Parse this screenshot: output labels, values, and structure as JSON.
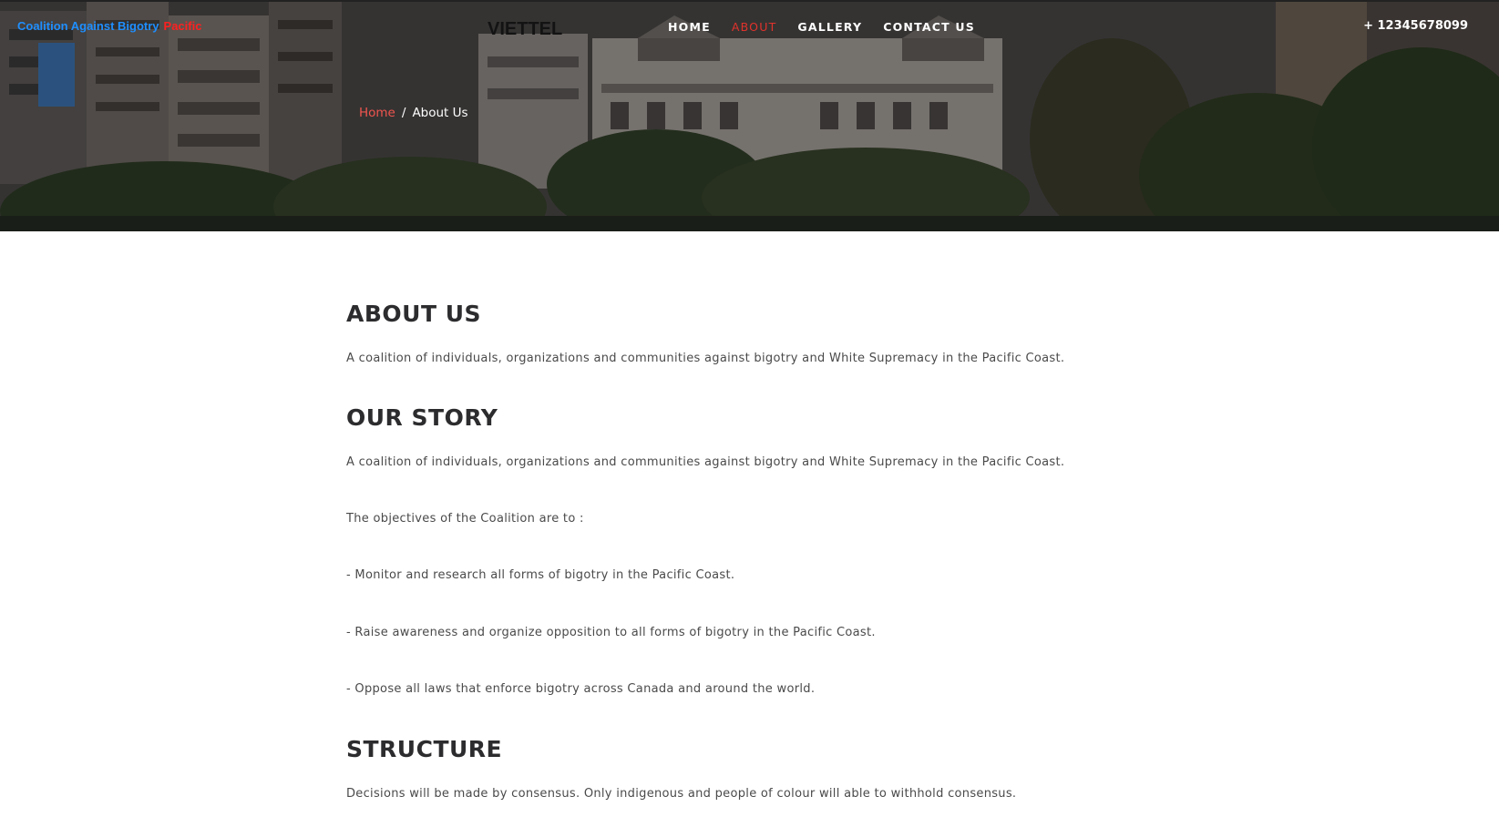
{
  "header": {
    "brand_primary": "Coalition Against Bigotry",
    "brand_secondary": "Pacific",
    "nav": [
      {
        "label": "HOME"
      },
      {
        "label": "ABOUT"
      },
      {
        "label": "GALLERY"
      },
      {
        "label": "CONTACT US"
      }
    ],
    "active_nav": "ABOUT",
    "phone": "+ 12345678099"
  },
  "breadcrumb": {
    "home": "Home",
    "separator": "/",
    "current": "About Us"
  },
  "content": {
    "about_heading": "ABOUT US",
    "about_text": "A coalition of individuals, organizations and communities against bigotry and White Supremacy in the Pacific Coast.",
    "story_heading": "OUR STORY",
    "story_paragraphs": [
      "A coalition of individuals, organizations and communities against bigotry and White Supremacy in the Pacific Coast.",
      "The objectives of the Coalition are to :",
      "- Monitor and research all forms of bigotry in the Pacific Coast.",
      "- Raise awareness and organize opposition to all forms of bigotry in the Pacific Coast.",
      "- Oppose all laws that enforce bigotry across Canada and around the world."
    ],
    "structure_heading": "STRUCTURE",
    "structure_text": "Decisions will be made by consensus. Only indigenous and people of colour will able to withhold consensus."
  },
  "colors": {
    "brand_blue": "#1f8fff",
    "brand_red": "#ff2020",
    "active_nav": "#e0322b",
    "breadcrumb_home": "#f0554e",
    "heading": "#2c2c2e",
    "body_text": "#4a4a4a"
  },
  "hero_image_sign": "VIETTEL"
}
